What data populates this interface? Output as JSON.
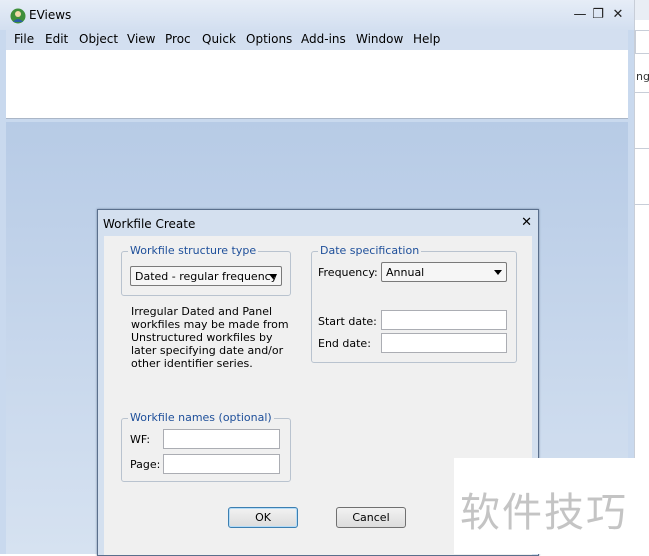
{
  "app": {
    "title": "EViews",
    "menu": [
      "File",
      "Edit",
      "Object",
      "View",
      "Proc",
      "Quick",
      "Options",
      "Add-ins",
      "Window",
      "Help"
    ],
    "controls": {
      "minimize": "—",
      "restore": "❐",
      "close": "✕"
    }
  },
  "side_strip": {
    "visible_fragment": "ng"
  },
  "dialog": {
    "title": "Workfile Create",
    "close_glyph": "✕",
    "structure_group": {
      "legend": "Workfile structure type",
      "selected": "Dated - regular frequency"
    },
    "info_text": "Irregular Dated and Panel workfiles may be made from Unstructured workfiles by later specifying date and/or other identifier series.",
    "date_group": {
      "legend": "Date specification",
      "frequency_label": "Frequency:",
      "frequency_value": "Annual",
      "start_label": "Start date:",
      "start_value": "",
      "end_label": "End date:",
      "end_value": ""
    },
    "names_group": {
      "legend": "Workfile names (optional)",
      "wf_label": "WF:",
      "wf_value": "",
      "page_label": "Page:",
      "page_value": ""
    },
    "ok_label": "OK",
    "cancel_label": "Cancel"
  },
  "watermark": {
    "text": "软件技巧"
  },
  "colors": {
    "titlebar": "#d3dff0",
    "workspace": "#c9d9ee",
    "legend_text": "#1e4f9a",
    "dialog_face": "#f0f0f0"
  }
}
